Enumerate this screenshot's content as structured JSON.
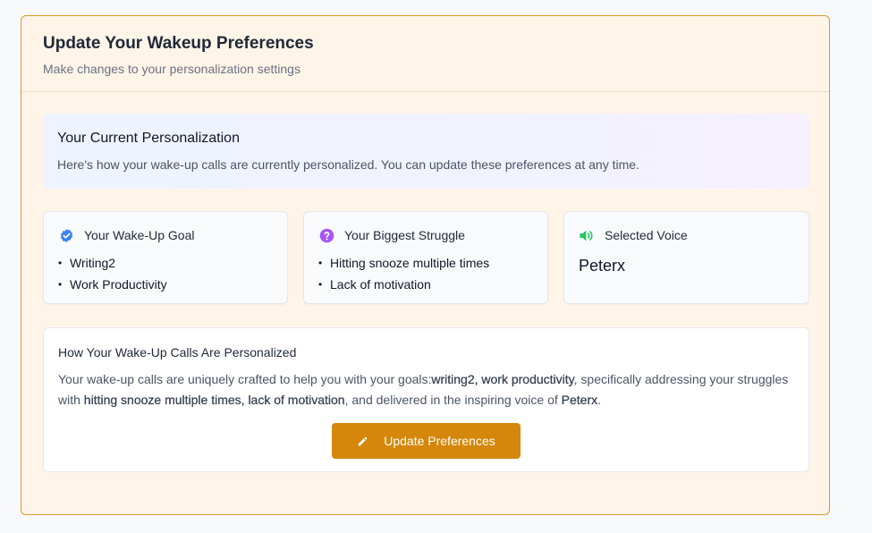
{
  "header": {
    "title": "Update Your Wakeup Preferences",
    "subtitle": "Make changes to your personalization settings"
  },
  "current": {
    "title": "Your Current Personalization",
    "text": "Here's how your wake-up calls are currently personalized. You can update these preferences at any time."
  },
  "goal": {
    "title": "Your Wake-Up Goal",
    "icon": "check-badge-icon",
    "icon_color": "#3b82f6",
    "items": [
      "Writing2",
      "Work Productivity"
    ]
  },
  "struggle": {
    "title": "Your Biggest Struggle",
    "icon": "question-circle-icon",
    "icon_color": "#a855f7",
    "items": [
      "Hitting snooze multiple times",
      "Lack of motivation"
    ]
  },
  "voice": {
    "title": "Selected Voice",
    "icon": "speaker-icon",
    "icon_color": "#22c55e",
    "name": "Peterx"
  },
  "personalization": {
    "title": "How Your Wake-Up Calls Are Personalized",
    "text_1": "Your wake-up calls are uniquely crafted to help you with your goals:",
    "goals": "writing2, work productivity",
    "text_2": ", specifically addressing your struggles with ",
    "struggles": "hitting snooze multiple times, lack of motivation",
    "text_3": ", and delivered in the inspiring voice of ",
    "voice": "Peterx",
    "text_4": "."
  },
  "button": {
    "label": "Update Preferences",
    "icon": "pencil-icon",
    "color": "#d4870a"
  },
  "colors": {
    "card_border": "#d99a2b",
    "card_background": "#fff4e8"
  }
}
